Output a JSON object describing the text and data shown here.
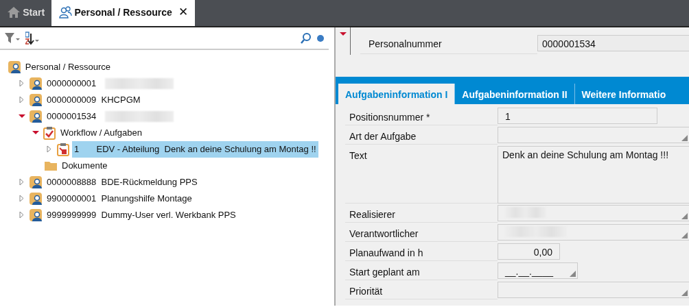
{
  "app_tabs": [
    {
      "label": "Start",
      "selected": false
    },
    {
      "label": "Personal / Ressource",
      "selected": true,
      "close": "✕"
    }
  ],
  "tree": {
    "label": "Personal / Ressource",
    "kind": "person",
    "selected": false,
    "children": [
      {
        "number": "0000000001",
        "redacted": true,
        "kind": "person",
        "expanded": false,
        "selected": false
      },
      {
        "number": "0000000009",
        "name": "KHCPGM",
        "kind": "person",
        "expanded": false,
        "selected": false
      },
      {
        "number": "0000001534",
        "redacted": true,
        "kind": "person",
        "expanded": true,
        "selected": false,
        "children": [
          {
            "label": "Workflow / Aufgaben",
            "kind": "workflow",
            "expanded": true,
            "selected": false,
            "children": [
              {
                "number": "1",
                "name": "EDV - Abteilung",
                "note": "Denk an deine Schulung am Montag !!",
                "kind": "task",
                "expanded": false,
                "selected": true
              }
            ]
          },
          {
            "label": "Dokumente",
            "kind": "folder",
            "selected": false
          }
        ]
      },
      {
        "number": "0000008888",
        "name": "BDE-Rückmeldung PPS",
        "kind": "person",
        "expanded": false,
        "selected": false
      },
      {
        "number": "9900000001",
        "name": "Planungshilfe Montage",
        "kind": "person",
        "expanded": false,
        "selected": false
      },
      {
        "number": "9999999999",
        "name": "Dummy-User verl. Werkbank PPS",
        "kind": "person",
        "expanded": false,
        "selected": false
      }
    ]
  },
  "header": {
    "expanded": true,
    "label": "Personalnummer",
    "value": "0000001534"
  },
  "detail_tabs": [
    {
      "label": "Aufgabeninformation I",
      "selected": true
    },
    {
      "label": "Aufgabeninformation II",
      "selected": false
    },
    {
      "label": "Weitere Informatio",
      "selected": false
    }
  ],
  "fields": [
    {
      "label": "Positionsnummer *",
      "kind": "text",
      "value": "1"
    },
    {
      "label": "Art der Aufgabe",
      "kind": "dropdown"
    },
    {
      "label": "Text",
      "kind": "textarea",
      "value": "Denk an deine Schulung am Montag !!!"
    },
    {
      "label": "Realisierer",
      "kind": "dropdown",
      "redacted": true
    },
    {
      "label": "Verantwortlicher",
      "kind": "dropdown",
      "redacted": true
    },
    {
      "label": "Planaufwand in h",
      "kind": "number",
      "value": "0,00"
    },
    {
      "label": "Start geplant am",
      "kind": "date",
      "value": "__.__.____"
    },
    {
      "label": "Priorität",
      "kind": "dropdown"
    }
  ]
}
